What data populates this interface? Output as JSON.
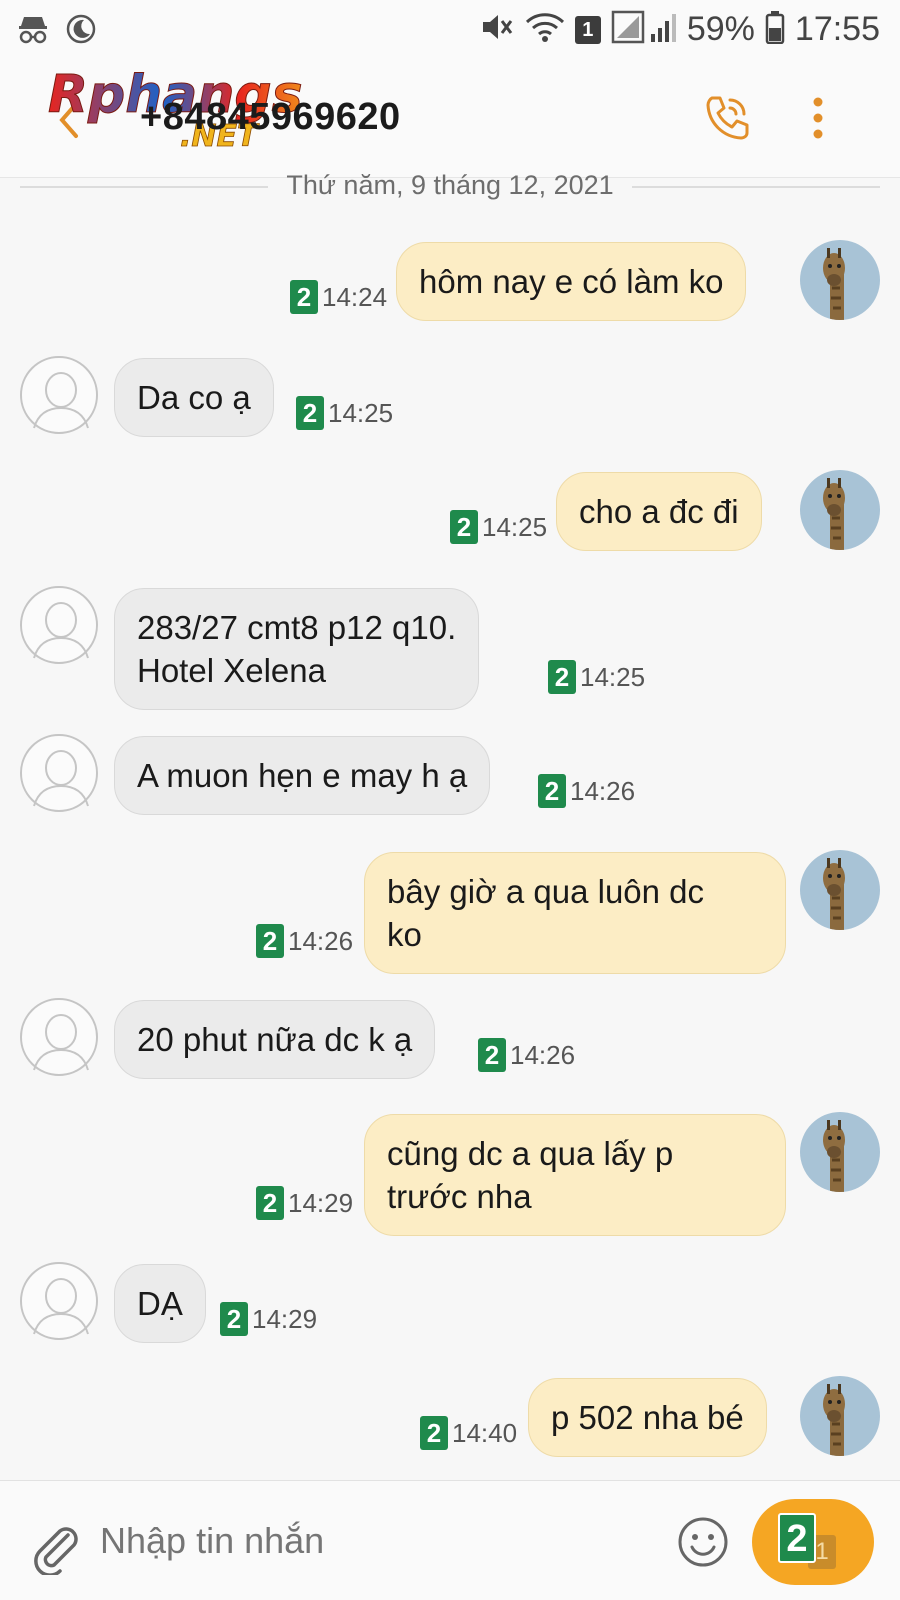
{
  "status_bar": {
    "battery": "59%",
    "time": "17:55",
    "sim_slot": "1"
  },
  "header": {
    "logo_text": "Rphangs",
    "logo_suffix": ".NET",
    "contact": "+84845969620"
  },
  "date_divider": "Thứ năm, 9 tháng 12, 2021",
  "messages": [
    {
      "dir": "out",
      "text": "hôm nay e có làm ko",
      "time": "14:24",
      "sim": "2"
    },
    {
      "dir": "in",
      "text": "Da co ạ",
      "time": "14:25",
      "sim": "2"
    },
    {
      "dir": "out",
      "text": "cho a đc đi",
      "time": "14:25",
      "sim": "2"
    },
    {
      "dir": "in",
      "text": "283/27 cmt8 p12 q10.",
      "text2": "Hotel Xelena",
      "time": "14:25",
      "sim": "2"
    },
    {
      "dir": "in",
      "text": "A muon hẹn e may h ạ",
      "time": "14:26",
      "sim": "2"
    },
    {
      "dir": "out",
      "text": "bây giờ a qua luôn dc",
      "text2": "ko",
      "time": "14:26",
      "sim": "2"
    },
    {
      "dir": "in",
      "text": "20 phut nữa dc k ạ",
      "time": "14:26",
      "sim": "2"
    },
    {
      "dir": "out",
      "text": "cũng dc a qua lấy p",
      "text2": "trước nha",
      "time": "14:29",
      "sim": "2"
    },
    {
      "dir": "in",
      "text": "DẠ",
      "time": "14:29",
      "sim": "2"
    },
    {
      "dir": "out",
      "text": "p 502 nha bé",
      "time": "14:40",
      "sim": "2"
    }
  ],
  "composer": {
    "placeholder": "Nhập tin nhắn",
    "send_sim": "2",
    "send_sim_secondary": "1"
  },
  "colors": {
    "accent": "#f5a623",
    "outgoing_bubble": "#fcedc5",
    "incoming_bubble": "#ebebeb",
    "sim_badge": "#1f8a4c"
  }
}
